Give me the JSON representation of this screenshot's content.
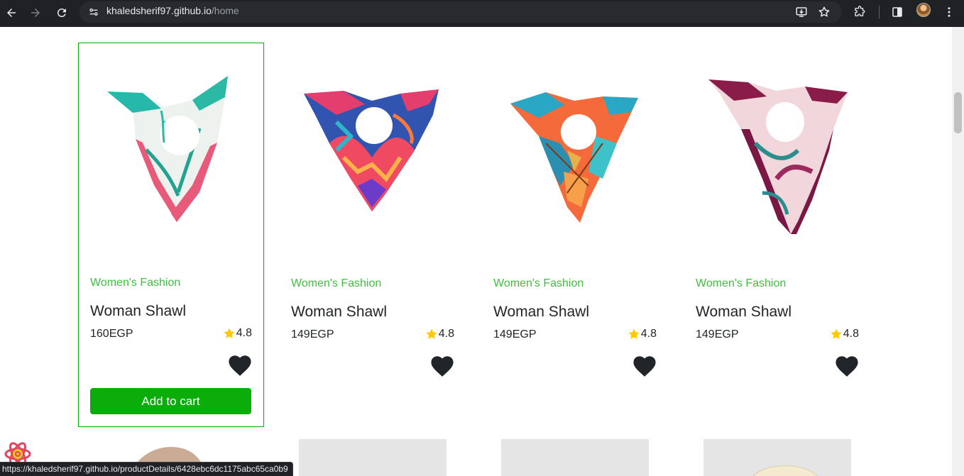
{
  "browser": {
    "url_domain": "khaledsherif97.github.io",
    "url_path": "/home",
    "status_url": "https://khaledsherif97.github.io/productDetails/6428ebc6dc1175abc65ca0b9"
  },
  "products": [
    {
      "category": "Women's Fashion",
      "title": "Woman Shawl",
      "price": "160EGP",
      "rating": "4.8",
      "add_to_cart": "Add to cart"
    },
    {
      "category": "Women's Fashion",
      "title": "Woman Shawl",
      "price": "149EGP",
      "rating": "4.8"
    },
    {
      "category": "Women's Fashion",
      "title": "Woman Shawl",
      "price": "149EGP",
      "rating": "4.8"
    },
    {
      "category": "Women's Fashion",
      "title": "Woman Shawl",
      "price": "149EGP",
      "rating": "4.8"
    }
  ],
  "colors": {
    "accent_green": "#0aad0a",
    "star": "#ffc908",
    "heart": "#212529"
  },
  "icons": [
    "back-icon",
    "forward-icon",
    "reload-icon",
    "site-info-icon",
    "install-icon",
    "bookmark-star-icon",
    "extensions-icon",
    "side-panel-icon",
    "profile-avatar",
    "menu-icon",
    "star-icon",
    "heart-icon",
    "react-devtools-icon"
  ]
}
